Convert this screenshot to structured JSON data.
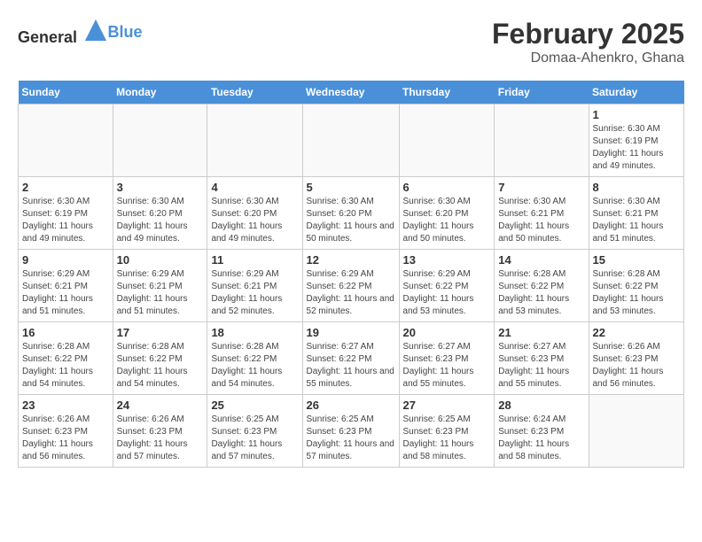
{
  "header": {
    "logo_general": "General",
    "logo_blue": "Blue",
    "month": "February 2025",
    "location": "Domaa-Ahenkro, Ghana"
  },
  "days_of_week": [
    "Sunday",
    "Monday",
    "Tuesday",
    "Wednesday",
    "Thursday",
    "Friday",
    "Saturday"
  ],
  "weeks": [
    [
      {
        "day": "",
        "info": ""
      },
      {
        "day": "",
        "info": ""
      },
      {
        "day": "",
        "info": ""
      },
      {
        "day": "",
        "info": ""
      },
      {
        "day": "",
        "info": ""
      },
      {
        "day": "",
        "info": ""
      },
      {
        "day": "1",
        "info": "Sunrise: 6:30 AM\nSunset: 6:19 PM\nDaylight: 11 hours and 49 minutes."
      }
    ],
    [
      {
        "day": "2",
        "info": "Sunrise: 6:30 AM\nSunset: 6:19 PM\nDaylight: 11 hours and 49 minutes."
      },
      {
        "day": "3",
        "info": "Sunrise: 6:30 AM\nSunset: 6:20 PM\nDaylight: 11 hours and 49 minutes."
      },
      {
        "day": "4",
        "info": "Sunrise: 6:30 AM\nSunset: 6:20 PM\nDaylight: 11 hours and 49 minutes."
      },
      {
        "day": "5",
        "info": "Sunrise: 6:30 AM\nSunset: 6:20 PM\nDaylight: 11 hours and 50 minutes."
      },
      {
        "day": "6",
        "info": "Sunrise: 6:30 AM\nSunset: 6:20 PM\nDaylight: 11 hours and 50 minutes."
      },
      {
        "day": "7",
        "info": "Sunrise: 6:30 AM\nSunset: 6:21 PM\nDaylight: 11 hours and 50 minutes."
      },
      {
        "day": "8",
        "info": "Sunrise: 6:30 AM\nSunset: 6:21 PM\nDaylight: 11 hours and 51 minutes."
      }
    ],
    [
      {
        "day": "9",
        "info": "Sunrise: 6:29 AM\nSunset: 6:21 PM\nDaylight: 11 hours and 51 minutes."
      },
      {
        "day": "10",
        "info": "Sunrise: 6:29 AM\nSunset: 6:21 PM\nDaylight: 11 hours and 51 minutes."
      },
      {
        "day": "11",
        "info": "Sunrise: 6:29 AM\nSunset: 6:21 PM\nDaylight: 11 hours and 52 minutes."
      },
      {
        "day": "12",
        "info": "Sunrise: 6:29 AM\nSunset: 6:22 PM\nDaylight: 11 hours and 52 minutes."
      },
      {
        "day": "13",
        "info": "Sunrise: 6:29 AM\nSunset: 6:22 PM\nDaylight: 11 hours and 53 minutes."
      },
      {
        "day": "14",
        "info": "Sunrise: 6:28 AM\nSunset: 6:22 PM\nDaylight: 11 hours and 53 minutes."
      },
      {
        "day": "15",
        "info": "Sunrise: 6:28 AM\nSunset: 6:22 PM\nDaylight: 11 hours and 53 minutes."
      }
    ],
    [
      {
        "day": "16",
        "info": "Sunrise: 6:28 AM\nSunset: 6:22 PM\nDaylight: 11 hours and 54 minutes."
      },
      {
        "day": "17",
        "info": "Sunrise: 6:28 AM\nSunset: 6:22 PM\nDaylight: 11 hours and 54 minutes."
      },
      {
        "day": "18",
        "info": "Sunrise: 6:28 AM\nSunset: 6:22 PM\nDaylight: 11 hours and 54 minutes."
      },
      {
        "day": "19",
        "info": "Sunrise: 6:27 AM\nSunset: 6:22 PM\nDaylight: 11 hours and 55 minutes."
      },
      {
        "day": "20",
        "info": "Sunrise: 6:27 AM\nSunset: 6:23 PM\nDaylight: 11 hours and 55 minutes."
      },
      {
        "day": "21",
        "info": "Sunrise: 6:27 AM\nSunset: 6:23 PM\nDaylight: 11 hours and 55 minutes."
      },
      {
        "day": "22",
        "info": "Sunrise: 6:26 AM\nSunset: 6:23 PM\nDaylight: 11 hours and 56 minutes."
      }
    ],
    [
      {
        "day": "23",
        "info": "Sunrise: 6:26 AM\nSunset: 6:23 PM\nDaylight: 11 hours and 56 minutes."
      },
      {
        "day": "24",
        "info": "Sunrise: 6:26 AM\nSunset: 6:23 PM\nDaylight: 11 hours and 57 minutes."
      },
      {
        "day": "25",
        "info": "Sunrise: 6:25 AM\nSunset: 6:23 PM\nDaylight: 11 hours and 57 minutes."
      },
      {
        "day": "26",
        "info": "Sunrise: 6:25 AM\nSunset: 6:23 PM\nDaylight: 11 hours and 57 minutes."
      },
      {
        "day": "27",
        "info": "Sunrise: 6:25 AM\nSunset: 6:23 PM\nDaylight: 11 hours and 58 minutes."
      },
      {
        "day": "28",
        "info": "Sunrise: 6:24 AM\nSunset: 6:23 PM\nDaylight: 11 hours and 58 minutes."
      },
      {
        "day": "",
        "info": ""
      }
    ]
  ]
}
